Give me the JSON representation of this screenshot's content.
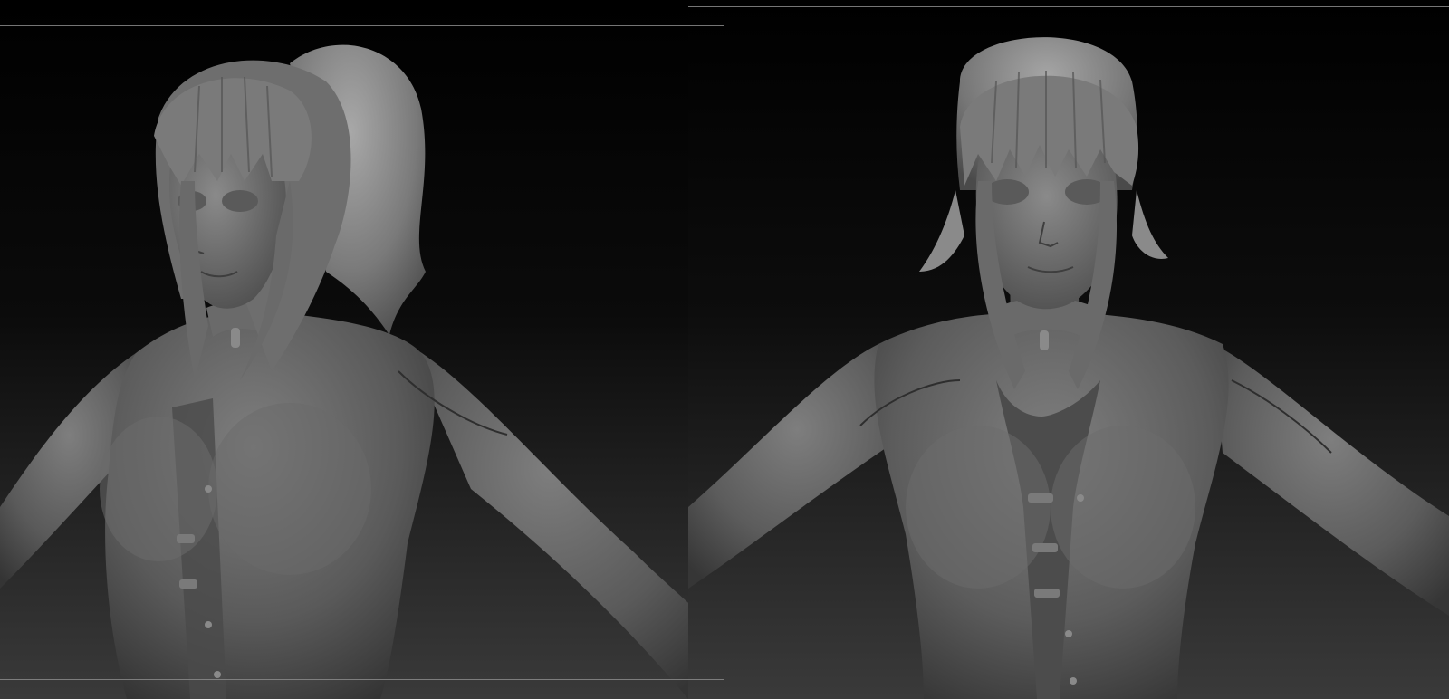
{
  "scene": {
    "background_top": "#000000",
    "background_bottom": "#3a3a3a",
    "clay_color": "#5e5e5e",
    "clay_highlight": "#8c8c8c",
    "clay_shadow": "#2a2a2a",
    "frame_line_color": "#8a8a8a"
  },
  "viewports": [
    {
      "id": "left",
      "view": "three-quarter",
      "model": "female-character-sculpt"
    },
    {
      "id": "right",
      "view": "front",
      "model": "female-character-sculpt"
    }
  ]
}
